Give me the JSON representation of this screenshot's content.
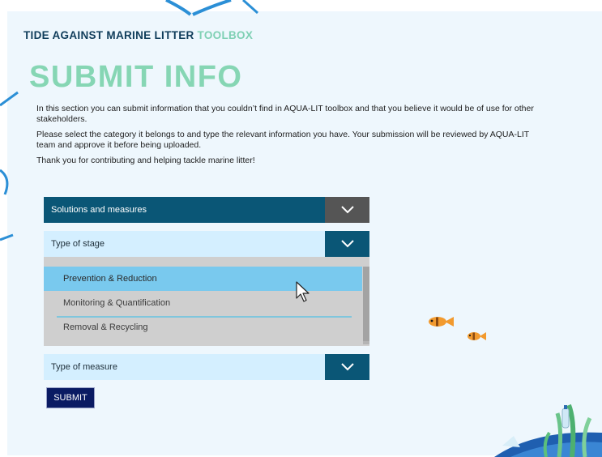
{
  "header": {
    "brand": "TIDE AGAINST MARINE LITTER",
    "brand_accent": "TOOLBOX"
  },
  "page_title": "SUBMIT INFO",
  "intro": [
    "In this section you can submit information that you couldn’t find in AQUA-LIT toolbox and that you believe it would be of use for other stakeholders.",
    "Please select the category it belongs to and type the relevant information you have. Your submission will be reviewed by AQUA-LIT team and approve it before being uploaded.",
    "Thank you for contributing and helping tackle marine litter!"
  ],
  "form": {
    "category_select": {
      "value": "Solutions and measures",
      "icon": "chevron-down-icon"
    },
    "stage_select": {
      "value": "Type of stage",
      "icon": "chevron-down-icon",
      "options": [
        "Prevention & Reduction",
        "Monitoring & Quantification",
        "Removal & Recycling"
      ],
      "highlighted": "Prevention & Reduction"
    },
    "measure_select": {
      "value": "Type of measure",
      "icon": "chevron-down-icon"
    },
    "submit_label": "SUBMIT"
  },
  "colors": {
    "brand_navy": "#0f3c5a",
    "accent_green": "#86d6b4",
    "dropdown_dark": "#0a5676",
    "dropdown_light": "#d4efff",
    "option_highlight": "#79c9ee",
    "submit_bg": "#0a1b63",
    "fish": "#f29a2e"
  }
}
